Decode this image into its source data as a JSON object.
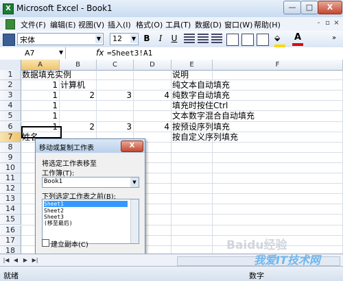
{
  "window": {
    "title": "Microsoft Excel - Book1"
  },
  "menu": [
    "文件(F)",
    "编辑(E)",
    "视图(V)",
    "插入(I)",
    "格式(O)",
    "工具(T)",
    "数据(D)",
    "窗口(W)",
    "帮助(H)"
  ],
  "help_box": {
    "placeholder": "键入需要帮助的问题"
  },
  "toolbar": {
    "font": "宋体",
    "font_size": "12",
    "bold": "B",
    "italic": "I",
    "underline": "U"
  },
  "formula_bar": {
    "name_box": "A7",
    "fx": "fx",
    "formula": "=Sheet3!A1"
  },
  "columns": [
    "A",
    "B",
    "C",
    "D",
    "E",
    "F"
  ],
  "rows": [
    "1",
    "2",
    "3",
    "4",
    "5",
    "6",
    "7",
    "8",
    "9",
    "10",
    "11",
    "12",
    "13",
    "14",
    "15",
    "16",
    "17",
    "18"
  ],
  "cells": {
    "A1": "数据填充实例",
    "E1": "说明",
    "A2": "1",
    "B2": "计算机",
    "E2": "纯文本自动填充",
    "A3": "1",
    "B3": "2",
    "C3": "3",
    "D3": "4",
    "E3": "纯数字自动填充",
    "A4": "1",
    "E4": "填充时按住Ctrl",
    "A5": "1",
    "E5": "文本数字混合自动填充",
    "A6": "1",
    "B6": "2",
    "C6": "3",
    "D6": "4",
    "E6": "按预设序列填充",
    "A7": "姓名",
    "E7": "按自定义序列填充"
  },
  "dialog": {
    "title": "移动或复制工作表",
    "move_to_label": "将选定工作表移至",
    "workbook_label": "工作簿(T):",
    "workbook_value": "Book1",
    "before_label": "下列选定工作表之前(B):",
    "sheets": [
      "Sheet1",
      "Sheet2",
      "Sheet3",
      "(移至最后)"
    ],
    "selected_sheet": "Sheet1",
    "copy_checkbox": "建立副本(C)",
    "copy_checked": false,
    "ok": "确定",
    "cancel": "取消",
    "close": "X"
  },
  "status": {
    "ready": "就绪",
    "mode": "数字"
  },
  "watermark": {
    "text1": "Baidu经验",
    "text2": "我爱IT技术网"
  }
}
